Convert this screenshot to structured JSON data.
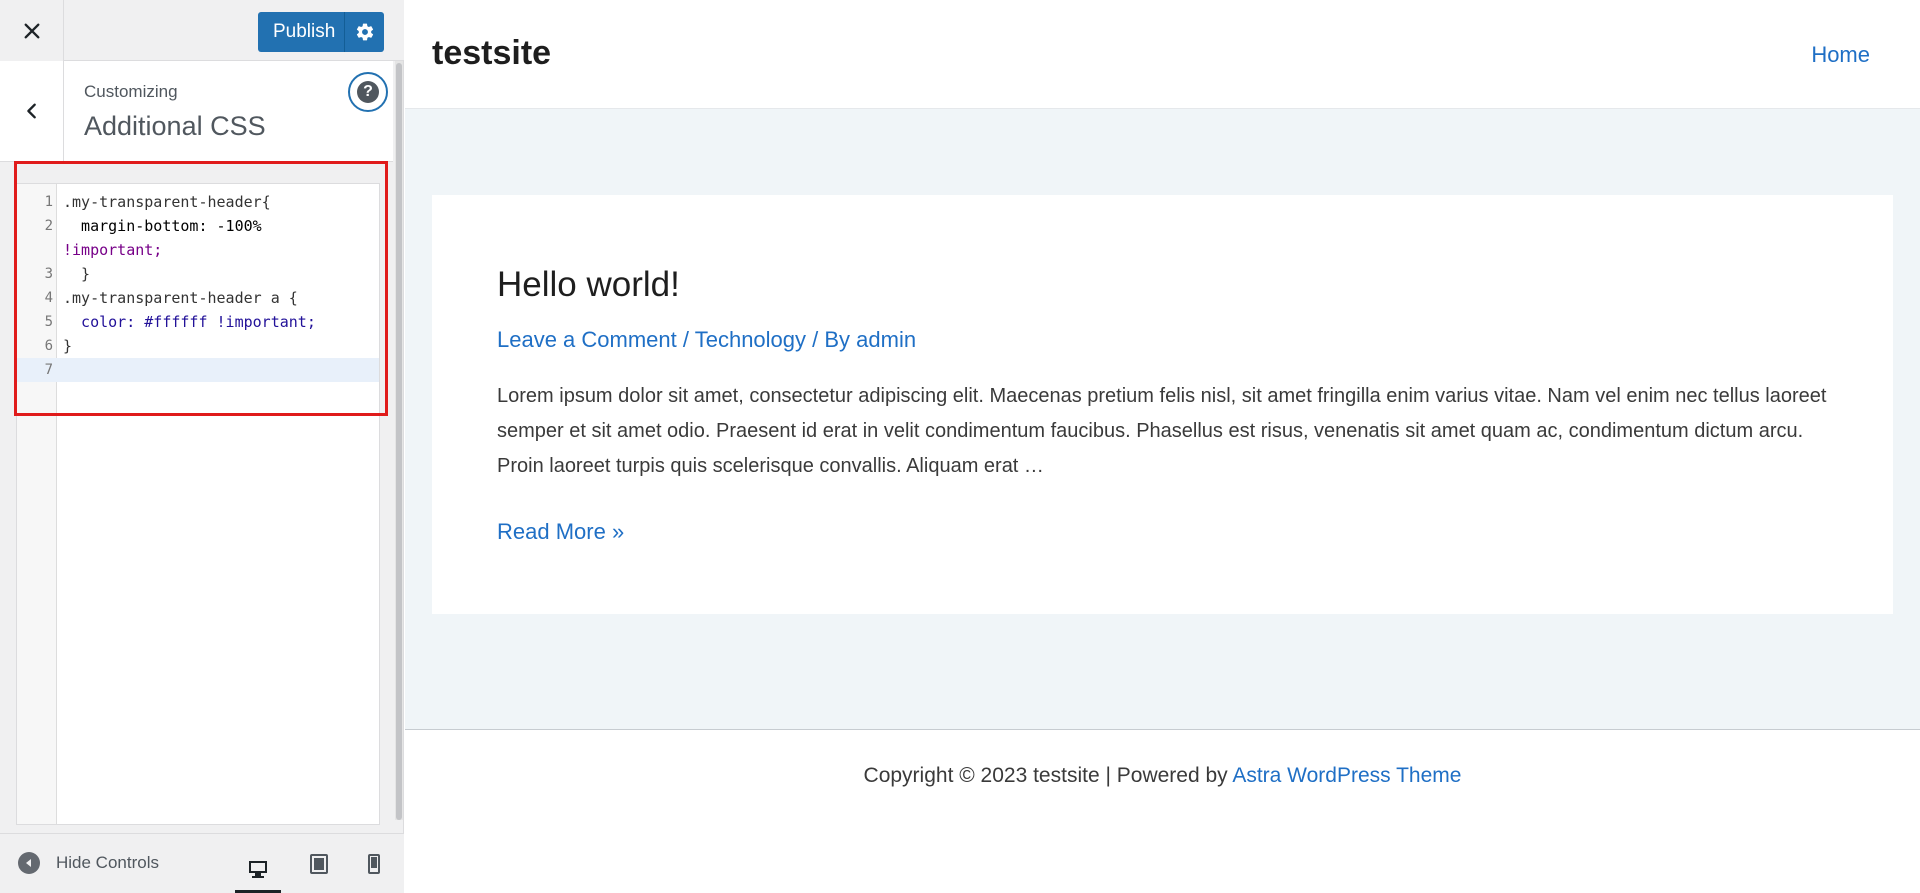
{
  "topbar": {
    "close_icon": "close-icon",
    "publish_label": "Publish",
    "settings_icon": "gear-icon"
  },
  "section": {
    "back_icon": "chevron-left-icon",
    "customizing_label": "Customizing",
    "title": "Additional CSS",
    "help_icon": "question-icon",
    "help_glyph": "?"
  },
  "editor": {
    "lines": [
      {
        "num": "1",
        "text": ".my-transparent-header{"
      },
      {
        "num": "2",
        "text": "  margin-bottom: -100%"
      },
      {
        "num": "",
        "text": "!important;"
      },
      {
        "num": "3",
        "text": "  }"
      },
      {
        "num": "4",
        "text": ".my-transparent-header a {"
      },
      {
        "num": "5",
        "text": "  color: #ffffff !important;"
      },
      {
        "num": "6",
        "text": "}"
      },
      {
        "num": "7",
        "text": ""
      }
    ]
  },
  "footer_controls": {
    "hide_controls_label": "Hide Controls",
    "devices": [
      "desktop-icon",
      "tablet-icon",
      "mobile-icon"
    ],
    "active_device": "desktop"
  },
  "preview": {
    "site_title": "testsite",
    "nav_home": "Home",
    "post": {
      "title": "Hello world!",
      "meta": {
        "comment_link": "Leave a Comment",
        "sep1": " / ",
        "category": "Technology",
        "sep2": " / By ",
        "author": "admin"
      },
      "excerpt": "Lorem ipsum dolor sit amet, consectetur adipiscing elit. Maecenas pretium felis nisl, sit amet fringilla enim varius vitae. Nam vel enim nec tellus laoreet semper et sit amet odio. Praesent id erat in velit condimentum faucibus. Phasellus est risus, venenatis sit amet quam ac, condimentum dictum arcu. Proin laoreet turpis quis scelerisque convallis. Aliquam erat …",
      "read_more": "Read More »"
    },
    "footer": {
      "copyright": "Copyright © 2023 testsite | Powered by ",
      "theme_link": "Astra WordPress Theme"
    }
  },
  "colors": {
    "accent": "#2271b1",
    "link": "#1f6fc5",
    "highlight": "#e01b1b"
  }
}
